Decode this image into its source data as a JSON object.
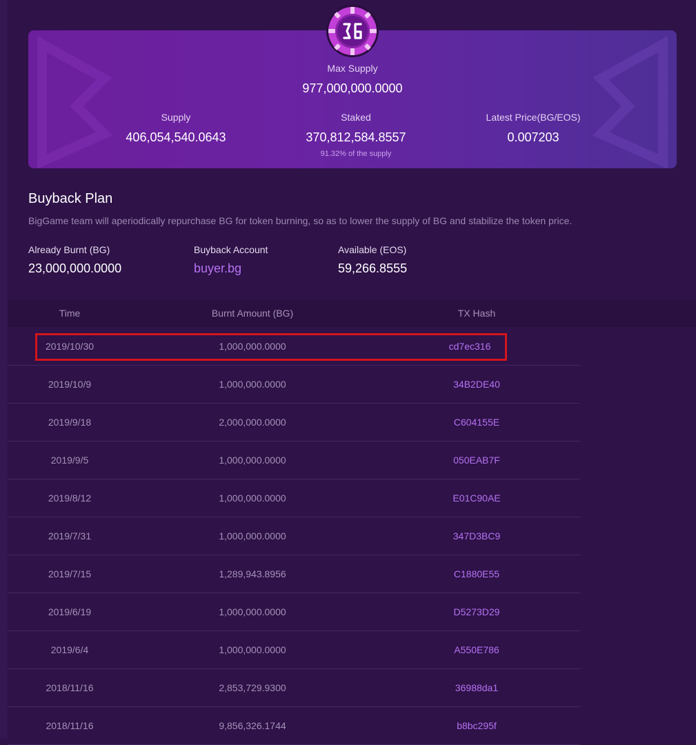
{
  "hero": {
    "max_supply_label": "Max Supply",
    "max_supply_value": "977,000,000.0000",
    "supply_label": "Supply",
    "supply_value": "406,054,540.0643",
    "staked_label": "Staked",
    "staked_value": "370,812,584.8557",
    "staked_note": "91.32% of the supply",
    "price_label": "Latest Price(BG/EOS)",
    "price_value": "0.007203"
  },
  "buyback": {
    "title": "Buyback Plan",
    "description": "BigGame team will aperiodically repurchase BG for token burning, so as to lower the supply of BG and stabilize the token price.",
    "burnt_label": "Already Burnt (BG)",
    "burnt_value": "23,000,000.0000",
    "account_label": "Buyback Account",
    "account_value": "buyer.bg",
    "available_label": "Available (EOS)",
    "available_value": "59,266.8555"
  },
  "table": {
    "headers": [
      "Time",
      "Burnt Amount (BG)",
      "TX Hash"
    ],
    "rows": [
      {
        "time": "2019/10/30",
        "amount": "1,000,000.0000",
        "hash": "cd7ec316"
      },
      {
        "time": "2019/10/9",
        "amount": "1,000,000.0000",
        "hash": "34B2DE40"
      },
      {
        "time": "2019/9/18",
        "amount": "2,000,000.0000",
        "hash": "C604155E"
      },
      {
        "time": "2019/9/5",
        "amount": "1,000,000.0000",
        "hash": "050EAB7F"
      },
      {
        "time": "2019/8/12",
        "amount": "1,000,000.0000",
        "hash": "E01C90AE"
      },
      {
        "time": "2019/7/31",
        "amount": "1,000,000.0000",
        "hash": "347D3BC9"
      },
      {
        "time": "2019/7/15",
        "amount": "1,289,943.8956",
        "hash": "C1880E55"
      },
      {
        "time": "2019/6/19",
        "amount": "1,000,000.0000",
        "hash": "D5273D29"
      },
      {
        "time": "2019/6/4",
        "amount": "1,000,000.0000",
        "hash": "A550E786"
      },
      {
        "time": "2018/11/16",
        "amount": "2,853,729.9300",
        "hash": "36988da1"
      },
      {
        "time": "2018/11/16",
        "amount": "9,856,326.1744",
        "hash": "b8bc295f"
      }
    ]
  },
  "colors": {
    "background": "#2e1248",
    "accent_link": "#b672f2",
    "highlight": "#d3141c"
  },
  "icons": {
    "logo": "bg-token-logo-icon"
  }
}
